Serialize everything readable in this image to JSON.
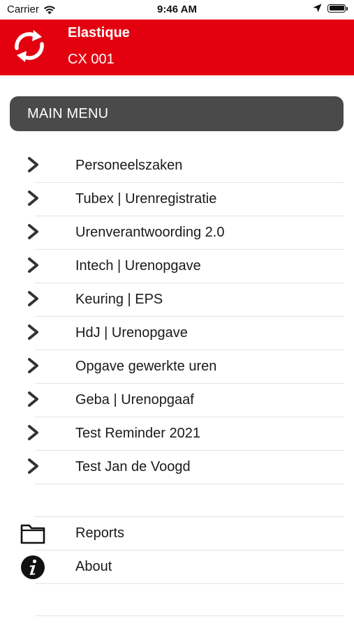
{
  "status_bar": {
    "carrier": "Carrier",
    "time": "9:46 AM",
    "icons": [
      "wifi-icon",
      "location-arrow-icon",
      "battery-icon"
    ]
  },
  "header": {
    "title": "Elastique",
    "subtitle": "CX 001",
    "icon": "sync-icon",
    "background_color": "#e3000f"
  },
  "main_menu": {
    "title": "MAIN MENU",
    "background_color": "#4a4a4a",
    "items": [
      {
        "label": "Personeelszaken",
        "icon": "chevron-right-icon"
      },
      {
        "label": "Tubex | Urenregistratie",
        "icon": "chevron-right-icon"
      },
      {
        "label": "Urenverantwoording 2.0",
        "icon": "chevron-right-icon"
      },
      {
        "label": "Intech | Urenopgave",
        "icon": "chevron-right-icon"
      },
      {
        "label": "Keuring | EPS",
        "icon": "chevron-right-icon"
      },
      {
        "label": "HdJ | Urenopgave",
        "icon": "chevron-right-icon"
      },
      {
        "label": "Opgave gewerkte uren",
        "icon": "chevron-right-icon"
      },
      {
        "label": "Geba | Urenopgaaf",
        "icon": "chevron-right-icon"
      },
      {
        "label": "Test Reminder 2021",
        "icon": "chevron-right-icon"
      },
      {
        "label": "Test Jan de Voogd",
        "icon": "chevron-right-icon"
      }
    ]
  },
  "extra_menu": {
    "items": [
      {
        "label": "Reports",
        "icon": "folder-icon"
      },
      {
        "label": "About",
        "icon": "info-icon"
      }
    ]
  }
}
